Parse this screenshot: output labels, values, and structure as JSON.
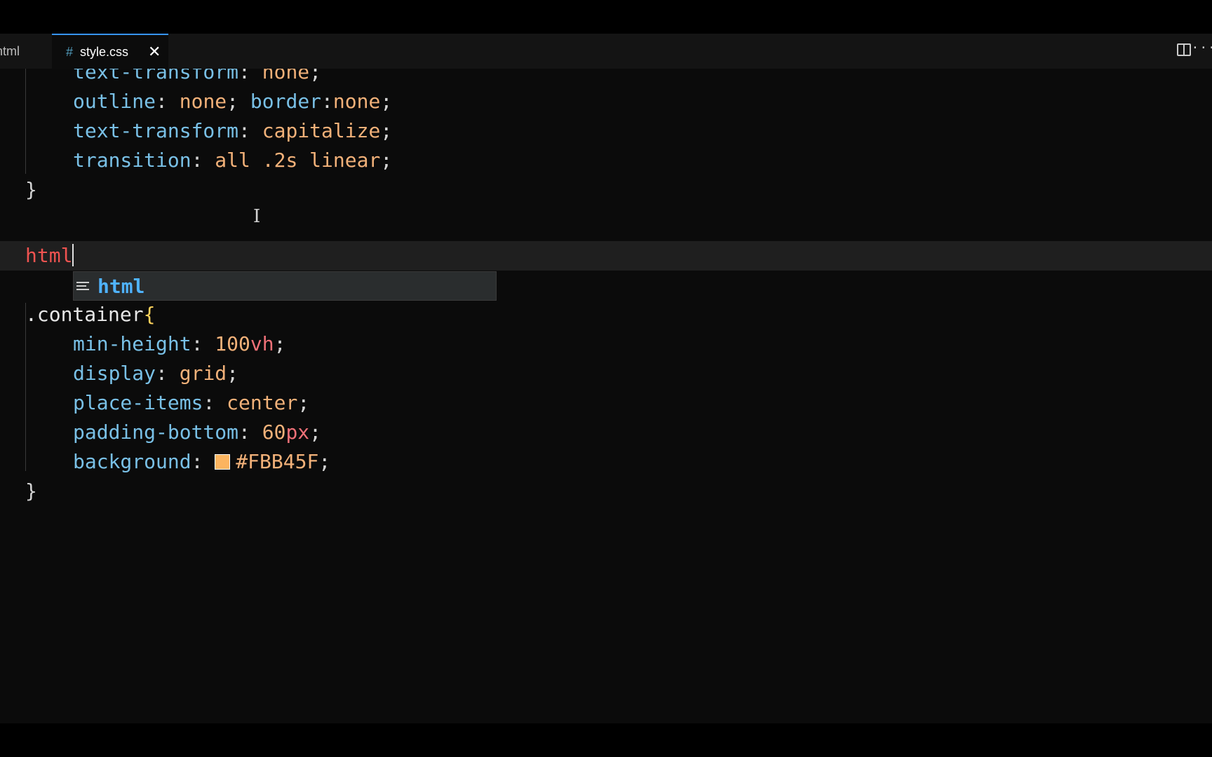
{
  "tabs": {
    "prev_label": "html",
    "active_label": "style.css",
    "active_icon": "hash-icon",
    "close_glyph": "✕"
  },
  "toolbar": {
    "split_icon": "split-editor-icon",
    "more_glyph": "···"
  },
  "code": {
    "l1": {
      "prop": "text-transform",
      "value": "none"
    },
    "l2": {
      "prop1": "outline",
      "value1": "none",
      "prop2": "border",
      "value2": "none"
    },
    "l3": {
      "prop": "text-transform",
      "value": "capitalize"
    },
    "l4": {
      "prop": "transition",
      "v1": "all",
      "v2": ".2s",
      "v3": "linear"
    },
    "l5": {
      "brace": "}"
    },
    "l7": {
      "typed": "html"
    },
    "l9": {
      "selector": ".container",
      "brace": "{"
    },
    "l10": {
      "prop": "min-height",
      "num": "100",
      "unit": "vh"
    },
    "l11": {
      "prop": "display",
      "value": "grid"
    },
    "l12": {
      "prop": "place-items",
      "value": "center"
    },
    "l13": {
      "prop": "padding-bottom",
      "num": "60",
      "unit": "px"
    },
    "l14": {
      "prop": "background",
      "value": "#FBB45F",
      "swatch": "#FBB45F"
    },
    "l15": {
      "brace": "}"
    }
  },
  "suggest": {
    "icon": "snippet-icon",
    "label": "html"
  },
  "colors": {
    "accent": "#3794ff",
    "property": "#79c0e6",
    "value": "#f2b179",
    "unit": "#f07178",
    "tag": "#ef5350"
  }
}
